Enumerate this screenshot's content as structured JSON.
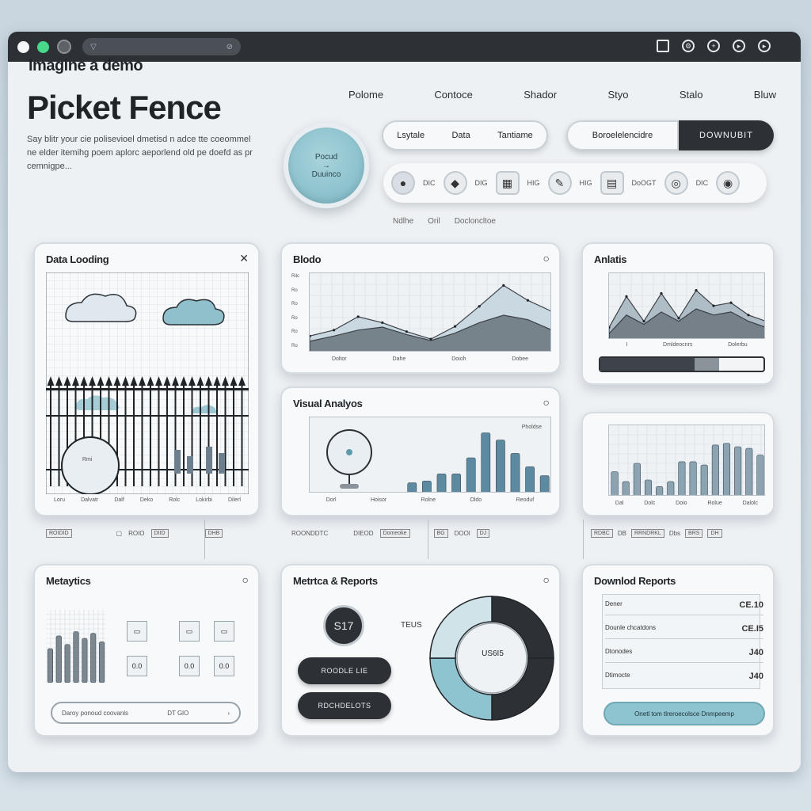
{
  "window": {
    "url_text": "▽",
    "url_end": "⊘"
  },
  "brand": {
    "subtitle": "Imagine a demo",
    "title": "Picket Fence",
    "description": "Say blitr your cie polisevioel dmetisd n adce tte coeommel ne elder itemihg poem aplorc aeporlend old pe doefd as pr cemnigpe..."
  },
  "topnav": [
    "Polome",
    "Contoce",
    "Shador",
    "Styo",
    "Stalo",
    "Bluw"
  ],
  "hero": {
    "big_button_line1": "Pocud",
    "big_button_line2": "Duuinco",
    "pills": [
      "Lsytale",
      "Data",
      "Tantiame"
    ],
    "toggle_left": "Boroelelencidre",
    "toggle_right": "DOWNUBIT",
    "iconbar": [
      {
        "icon": "circle-dot-icon",
        "glyph": "●",
        "label": "DIC"
      },
      {
        "icon": "diamond-icon",
        "glyph": "◆",
        "label": "DIG"
      },
      {
        "icon": "grid-icon",
        "glyph": "▦",
        "label": "HIG"
      },
      {
        "icon": "tool-icon",
        "glyph": "✎",
        "label": "HIG"
      },
      {
        "icon": "document-icon",
        "glyph": "▤",
        "label": "DoOGT"
      },
      {
        "icon": "chip-icon",
        "glyph": "◎",
        "label": "DIC"
      },
      {
        "icon": "user-icon",
        "glyph": "◉",
        "label": ""
      }
    ],
    "sublabels": [
      "Ndlhe",
      "Oril",
      "Docloncltoe"
    ]
  },
  "cards": {
    "data_loading": {
      "title": "Data Looding",
      "close": "✕",
      "badge": "Rmi",
      "axis": [
        "Loru",
        "Dalvatr",
        "Dalf",
        "Deko",
        "Rolc",
        "Lokirbi",
        "Dilerl"
      ]
    },
    "blodo": {
      "title": "Blodo",
      "corner": "○",
      "axis": [
        "Doltor",
        "Dahe",
        "Doioh",
        "Dobee"
      ],
      "yticks": [
        "Rilc",
        "Ro",
        "Ro",
        "Ro",
        "Ro",
        "Ro"
      ]
    },
    "anlatis": {
      "title": "Anlatis",
      "axis": [
        "I",
        "Dmldeocnrs",
        "Dolerbu"
      ]
    },
    "visual_analyses": {
      "title": "Visual Analyos",
      "corner": "○",
      "legend": "Pholdse",
      "axis": [
        "Dorl",
        "Hoisor",
        "Rolne",
        "Oldo",
        "Reoduf"
      ]
    },
    "bars_right": {
      "axis": [
        "Dal",
        "Dolc",
        "Doio",
        "Rolue",
        "Dalolc"
      ]
    },
    "metaytics": {
      "title": "Metaytics",
      "corner": "○",
      "search_text": "Daroy ponoud coovanls",
      "search_value": "DT GlO"
    },
    "metrics_reports": {
      "title": "Metrtca & Reports",
      "corner": "○",
      "circle_value": "S17",
      "btn1": "ROODLE LIE",
      "btn2": "RDCHDELOTS",
      "center_value": "US6I5",
      "side_value": "TEUS"
    },
    "download_reports": {
      "title": "Downlod Reports",
      "rows": [
        {
          "label": "Dener",
          "value": "CE.10"
        },
        {
          "label": "Dounle chcatdons",
          "value": "CE.I5"
        },
        {
          "label": "Dtonodes",
          "value": "J40"
        },
        {
          "label": "Dtimocte",
          "value": "J40"
        }
      ],
      "button": "Onetl tom tlreroecolsce Dnmpeemp"
    }
  },
  "strips": {
    "left": [
      "ROIDID",
      "ROIO",
      "DIID",
      "DHB"
    ],
    "mid": [
      "ROONDDTC",
      "DIEOD",
      "Domeoke",
      "BG",
      "DOOl",
      "DJ"
    ],
    "right": [
      "RDBC",
      "DB",
      "RRNDRKL",
      "Dbs",
      "BRS",
      "DH"
    ]
  },
  "chart_data": [
    {
      "type": "area",
      "title": "Blodo",
      "x": [
        1,
        2,
        3,
        4,
        5,
        6,
        7,
        8,
        9,
        10,
        11
      ],
      "series": [
        {
          "values": [
            22,
            30,
            48,
            40,
            28,
            18,
            35,
            62,
            90,
            70,
            55
          ]
        },
        {
          "values": [
            15,
            22,
            30,
            34,
            24,
            16,
            26,
            40,
            50,
            44,
            30
          ]
        }
      ]
    },
    {
      "type": "area",
      "title": "Anlatis",
      "x": [
        1,
        2,
        3,
        4,
        5,
        6,
        7,
        8,
        9,
        10
      ],
      "series": [
        {
          "values": [
            20,
            70,
            30,
            75,
            35,
            80,
            55,
            60,
            40,
            30
          ]
        },
        {
          "values": [
            10,
            40,
            25,
            45,
            30,
            50,
            40,
            45,
            30,
            20
          ]
        }
      ]
    },
    {
      "type": "bar",
      "title": "Visual Analyos",
      "values": [
        12,
        14,
        22,
        22,
        40,
        68,
        60,
        45,
        30,
        20
      ]
    },
    {
      "type": "bar",
      "values": [
        30,
        18,
        40,
        20,
        12,
        18,
        42,
        42,
        38,
        62,
        64,
        60,
        58,
        50
      ]
    },
    {
      "type": "bar",
      "title": "Metaytics",
      "values": [
        40,
        55,
        45,
        60,
        52,
        58,
        48
      ]
    },
    {
      "type": "pie",
      "title": "Metrtca & Reports",
      "values": [
        25,
        25,
        25,
        25
      ],
      "colors": [
        "#2d3136",
        "#2d3136",
        "#8ec4d0",
        "#cfe3e8"
      ]
    }
  ]
}
